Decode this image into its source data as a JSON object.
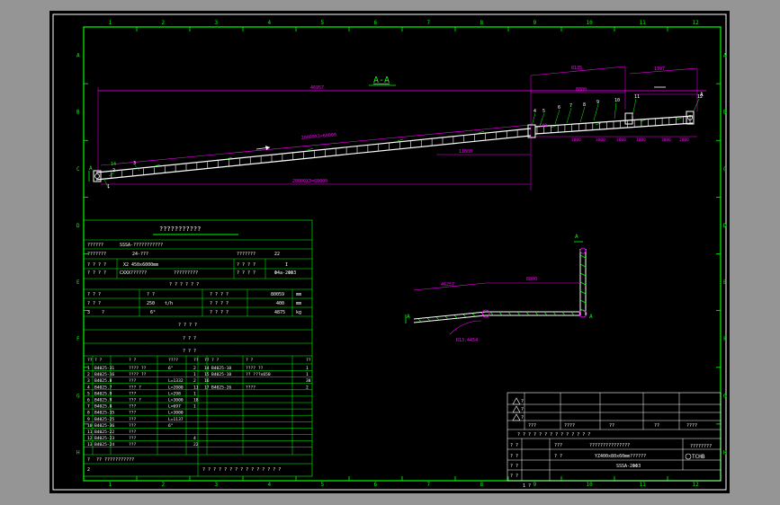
{
  "drawing": {
    "section_title": "A-A",
    "top_border_numbers": [
      "1",
      "2",
      "3",
      "4",
      "5",
      "6",
      "7",
      "8",
      "9",
      "10",
      "11",
      "12"
    ],
    "bottom_border_numbers": [
      "1",
      "2",
      "3",
      "4",
      "5",
      "6",
      "7",
      "8",
      "9",
      "10",
      "11",
      "12"
    ],
    "left_border_letters": [
      "A",
      "B",
      "C",
      "D",
      "E",
      "F",
      "G",
      "H"
    ],
    "right_border_letters": [
      "A",
      "B",
      "C",
      "D",
      "E",
      "F",
      "G",
      "H"
    ],
    "dimensions": {
      "overall_length": "46957",
      "dim_8135": "8135",
      "dim_1397": "1397",
      "dim_8800": "8800",
      "dim_11800": "11800",
      "incline_upper": "20000X3=60000",
      "incline_lower": "20000X3=60000",
      "dim_3000": "3000",
      "dim_2000": "2000",
      "dim_500": "500",
      "dim_1000": "1000"
    },
    "angle_label": "14",
    "section_marker": "A",
    "balloon_numbers": [
      "1",
      "2",
      "3",
      "4",
      "5",
      "6",
      "7",
      "8",
      "9",
      "10",
      "11",
      "12"
    ]
  },
  "plan_view": {
    "dim_left": "46257",
    "dim_right": "8800",
    "radius_label": "R13.4454",
    "marker": "A"
  },
  "spec_table": {
    "title": "???????????",
    "row1_label": "??????",
    "row1_value": "SSSA-???????????",
    "row2_label": "???????",
    "row2_value": "24-???",
    "row2_label2": "???????",
    "row2_value2": "22",
    "row3_label": "? ? ? ?",
    "row3_value": "X2 450x6000mm",
    "row3_label2": "? ? ? ?",
    "row3_value2": "I",
    "row4_label": "? ? ? ?",
    "row4_value": "CXXX??????",
    "row4_value_b": "?????????",
    "row4_label2": "? ? ? ?",
    "row4_value2": "Ф4a-2ФФ3",
    "section1_title": "? ? ? ? ? ?",
    "param_rows": [
      {
        "c1": "? ? ?",
        "c2": "? ?",
        "c3": "? ? ? ?",
        "c4": "80059",
        "c5": "mm"
      },
      {
        "c1": "? ? ?",
        "c2": "250",
        "c2u": "t/h",
        "c3": "? ? ? ?",
        "c4": "400",
        "c5": "mm"
      },
      {
        "c1": "3",
        "c2": "?",
        "c2b": "6°",
        "c3": "? ? ? ?",
        "c4": "4875",
        "c5": "kg"
      }
    ],
    "section2_title": "? ? ? ?",
    "section3_title": "? ? ?",
    "parts_header": [
      "??",
      "? ?",
      "? ?",
      "????",
      "??",
      "??",
      "? ?",
      "? ?",
      "??"
    ],
    "parts": [
      {
        "n": "1",
        "code": "B4025-31",
        "name": "???? ??",
        "spec": "6°",
        "qty": "2",
        "n2": "14",
        "code2": "B4025-10",
        "name2": "???? ??",
        "qty2": "1"
      },
      {
        "n": "2",
        "code": "B4025-16",
        "name": "???? ??",
        "spec": "",
        "qty": "1",
        "n2": "15",
        "code2": "B4025-10",
        "name2": "?? ???x650",
        "qty2": "1"
      },
      {
        "n": "3",
        "code": "B4025.8",
        "name": "???",
        "spec": "L=1332",
        "qty": "2",
        "n2": "16",
        "code2": "",
        "name2": "",
        "qty2": "38"
      },
      {
        "n": "4",
        "code": "B4025.7",
        "name": "??? ?",
        "spec": "L=2000",
        "qty": "11",
        "n2": "17",
        "code2": "B4025-26",
        "name2": "????",
        "qty2": "2"
      },
      {
        "n": "5",
        "code": "B4025.9",
        "name": "???",
        "spec": "L=298",
        "qty": "1",
        "n2": "",
        "code2": "",
        "name2": "",
        "qty2": ""
      },
      {
        "n": "6",
        "code": "B4025.9",
        "name": "??? ?",
        "spec": "L=3000",
        "qty": "18",
        "n2": "",
        "code2": "",
        "name2": "",
        "qty2": ""
      },
      {
        "n": "7",
        "code": "B4025.8",
        "name": "???",
        "spec": "L=697",
        "qty": "1",
        "n2": "",
        "code2": "",
        "name2": "",
        "qty2": ""
      },
      {
        "n": "8",
        "code": "B4025-35",
        "name": "???",
        "spec": "L=3000",
        "qty": "",
        "n2": "",
        "code2": "",
        "name2": "",
        "qty2": ""
      },
      {
        "n": "9",
        "code": "B4025-25",
        "name": "???",
        "spec": "L=1137",
        "qty": "",
        "n2": "",
        "code2": "",
        "name2": "",
        "qty2": ""
      },
      {
        "n": "10",
        "code": "B4025-36",
        "name": "???",
        "spec": "6°",
        "qty": "",
        "n2": "",
        "code2": "",
        "name2": "",
        "qty2": ""
      },
      {
        "n": "11",
        "code": "B4025-22",
        "name": "???",
        "spec": "",
        "qty": "",
        "n2": "",
        "code2": "",
        "name2": "",
        "qty2": ""
      },
      {
        "n": "12",
        "code": "B4025-23",
        "name": "???",
        "spec": "",
        "qty": "4",
        "n2": "",
        "code2": "",
        "name2": "",
        "qty2": ""
      },
      {
        "n": "13",
        "code": "B4025-24",
        "name": "???",
        "spec": "",
        "qty": "22",
        "n2": "",
        "code2": "",
        "name2": "",
        "qty2": ""
      }
    ],
    "note_label": "?",
    "note_text": "?? ???????????",
    "note_num": "2",
    "footer_text": "? ? ? ? ? ? ? ? ? ? ? ? ? ? ?"
  },
  "title_block": {
    "rev_rows": [
      "?",
      "?",
      "?"
    ],
    "sig_labels": [
      "???",
      "????",
      "??",
      "??",
      "????"
    ],
    "title_row": "? ? ? ? ? ? ? ? ? ? ? ? ? ?",
    "r1c1": "? ?",
    "r1c2": "???",
    "r1c3": "???????????????",
    "r2c1": "? ?",
    "r2c2": "? ?",
    "r2c3": "YZ400x80x60mm??????",
    "r3c1": "? ?",
    "r3c3": "SSSA-2ФФ3",
    "r4c1": "? ?",
    "company": "????????",
    "logo_text": "TCHB",
    "sheet_label": "1 ?"
  }
}
